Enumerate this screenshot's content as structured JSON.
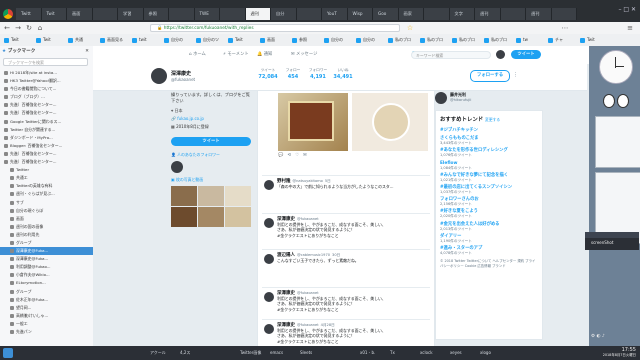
{
  "browser": {
    "tabs": [
      "Twitt",
      "Twit",
      "画面",
      "",
      "学習",
      "参照",
      "",
      "TWE",
      "",
      "週刊",
      "自分",
      "",
      "YouT",
      "Wisp",
      "Goo",
      "画家",
      "",
      "文字",
      "週刊",
      "",
      "週刊",
      ""
    ],
    "active_tab": "週刊 (Twitter)",
    "url": "https://twitter.com/fukuoanet/with_replies",
    "bookmarks": [
      "Twit",
      "Twit",
      "共通",
      "画面見る",
      "twit",
      "自分の",
      "自分のツ",
      "Twit",
      "画面",
      "参照",
      "自分の",
      "自分の",
      "私のブロ",
      "私のブロ",
      "私のブロ",
      "私のブロ",
      "tw",
      "チャ",
      "Twit"
    ]
  },
  "sidebar": {
    "title": "ブックマーク",
    "search_placeholder": "ブックマークを検索",
    "items": [
      "Hi 2018年/site at insta...",
      "HK3 Twitter@Yahoo!翻訳...",
      "今日の書籍閲覧について...",
      "ブログ（ブログ）...",
      "先進）百補強化センター...",
      "先進）百補強化センター...",
      "Google Twitterに関わるス...",
      "Twitter 自分が関連する...",
      "ダジンボード・MyPro...",
      "Blogger: 百補強化センター...",
      "先進）百補強化センター...",
      "先進）百補強化センター...",
      "Twitter",
      "共通エ",
      "Twitterの英雄な有料",
      "週刊・ぐらばが見ぶ...",
      "サブ",
      "自分の現ぐらぼ",
      "画面",
      "週刊の国の画像",
      "週刊の利用先",
      "グループ",
      "深澤康史@Fuka...",
      "深澤康史@Fuka...",
      "利用調整@Fukao...",
      "小倉作夫@Wikio...",
      "ELtorymotion...",
      "グループ",
      "佐木正年@Fuka...",
      "望月岡...",
      "高橋徹/けいしゃ...",
      "一般エ",
      "先進パン"
    ],
    "selected_index": 22
  },
  "twitter": {
    "nav": [
      "ホーム",
      "モーメント",
      "通知",
      "メッセージ"
    ],
    "search_placeholder": "キーワード検索",
    "tweet_button": "ツイート",
    "profile": {
      "name": "深澤康史",
      "handle": "@fukaoanet",
      "stats": [
        {
          "label": "ツイート",
          "value": "72,084"
        },
        {
          "label": "フォロー",
          "value": "454"
        },
        {
          "label": "フォロワー",
          "value": "4,191"
        },
        {
          "label": "いいね",
          "value": "34,491"
        }
      ],
      "follow_button": "フォローする",
      "bio": "繰りっています。詳しくは、ブログをご覧下さい",
      "location": "日本",
      "link": "fukao.jp.co.jp",
      "joined": "2010年8月に登録",
      "followers_you_know": "人のあなたのフォロワー",
      "photos_label": "枚の写真と動画"
    },
    "tweets": [
      {
        "name": "野村隆",
        "handle": "@natsuyakitomo",
        "time": "5日",
        "text": "「森の中の大」で前に知られるような当方がしたようなこのスタ..."
      },
      {
        "name": "深澤康史",
        "handle": "@fukaoanet",
        "time": "",
        "text": "利用との提供をし、やがまろこだ、成なする面こそ、美しい、\nさあ、私が価値決定の状で発見するように！\n#金クラクエストにありがちなこと"
      },
      {
        "name": "渡辺陽人",
        "handle": "@cablemusic1970",
        "time": "30日",
        "text": "こんなすごい玉子できたら、ずっと素敵だね。"
      },
      {
        "name": "深澤康史",
        "handle": "@fukaoanet",
        "time": "",
        "text": "利用との提供をし、やがまろこだ、成なする面こそ、美しい、\nさあ、私が価値決定の状で発見するように！\n#金クラクエストにありがちなこと"
      },
      {
        "name": "深澤康史",
        "handle": "@fukaoanet",
        "time": "4月28日",
        "text": "利用との提供をし、やがまろこだ、成なする面こそ、美しい、\nさあ、私が価値決定の状で発見するように！\n#金クラクエストにありがちなこと"
      }
    ],
    "right": {
      "follow_user": "藤井光利",
      "follow_handle": "@hikarufujii",
      "trends_title": "おすすめトレンド",
      "trends_change": "変更する",
      "trends": [
        {
          "tag": "#ジブハチキッチン",
          "count": ""
        },
        {
          "tag": "さくらもものこだま",
          "count": "3,443件のツイート"
        },
        {
          "tag": "#あなたを形作る世ロディレシング",
          "count": "1,076件のツイート"
        },
        {
          "tag": "Eleflow",
          "count": "1,084件のツイート"
        },
        {
          "tag": "#みんなで好きな夢にて記念を描く",
          "count": "1,021件のツイート"
        },
        {
          "tag": "#最初の店に出てくるスンプソイシン",
          "count": "1,037件のツイート"
        },
        {
          "tag": "フォロワーさんのお",
          "count": "2,156件のツイート"
        },
        {
          "tag": "#好きな夏をこよう",
          "count": "2,020件のツイート"
        },
        {
          "tag": "#金元を出会えた人は好がめる",
          "count": "2,013件のツイート"
        },
        {
          "tag": "ダイアリー",
          "count": "1,190件のツイート"
        },
        {
          "tag": "#進み・スターのアプ",
          "count": "4,078件のツイート"
        }
      ],
      "footer": "© 2018 Twitter  Twitterについて  ヘルプセンター  規約  プライバシーポリシー  Cookie  広告情報  ブランド"
    }
  },
  "right_desktop": {
    "screenshot_label": "screenShot"
  },
  "taskbar": {
    "items": [
      "アクール",
      "4,2ス",
      "",
      "Twitter画像",
      "emacs",
      "Sleets",
      "",
      "x01 - b.",
      "Tx",
      "xclock",
      "xeyes",
      "xlogo"
    ],
    "clock_time": "17:55",
    "clock_date": "2018年8月7日火曜日"
  }
}
